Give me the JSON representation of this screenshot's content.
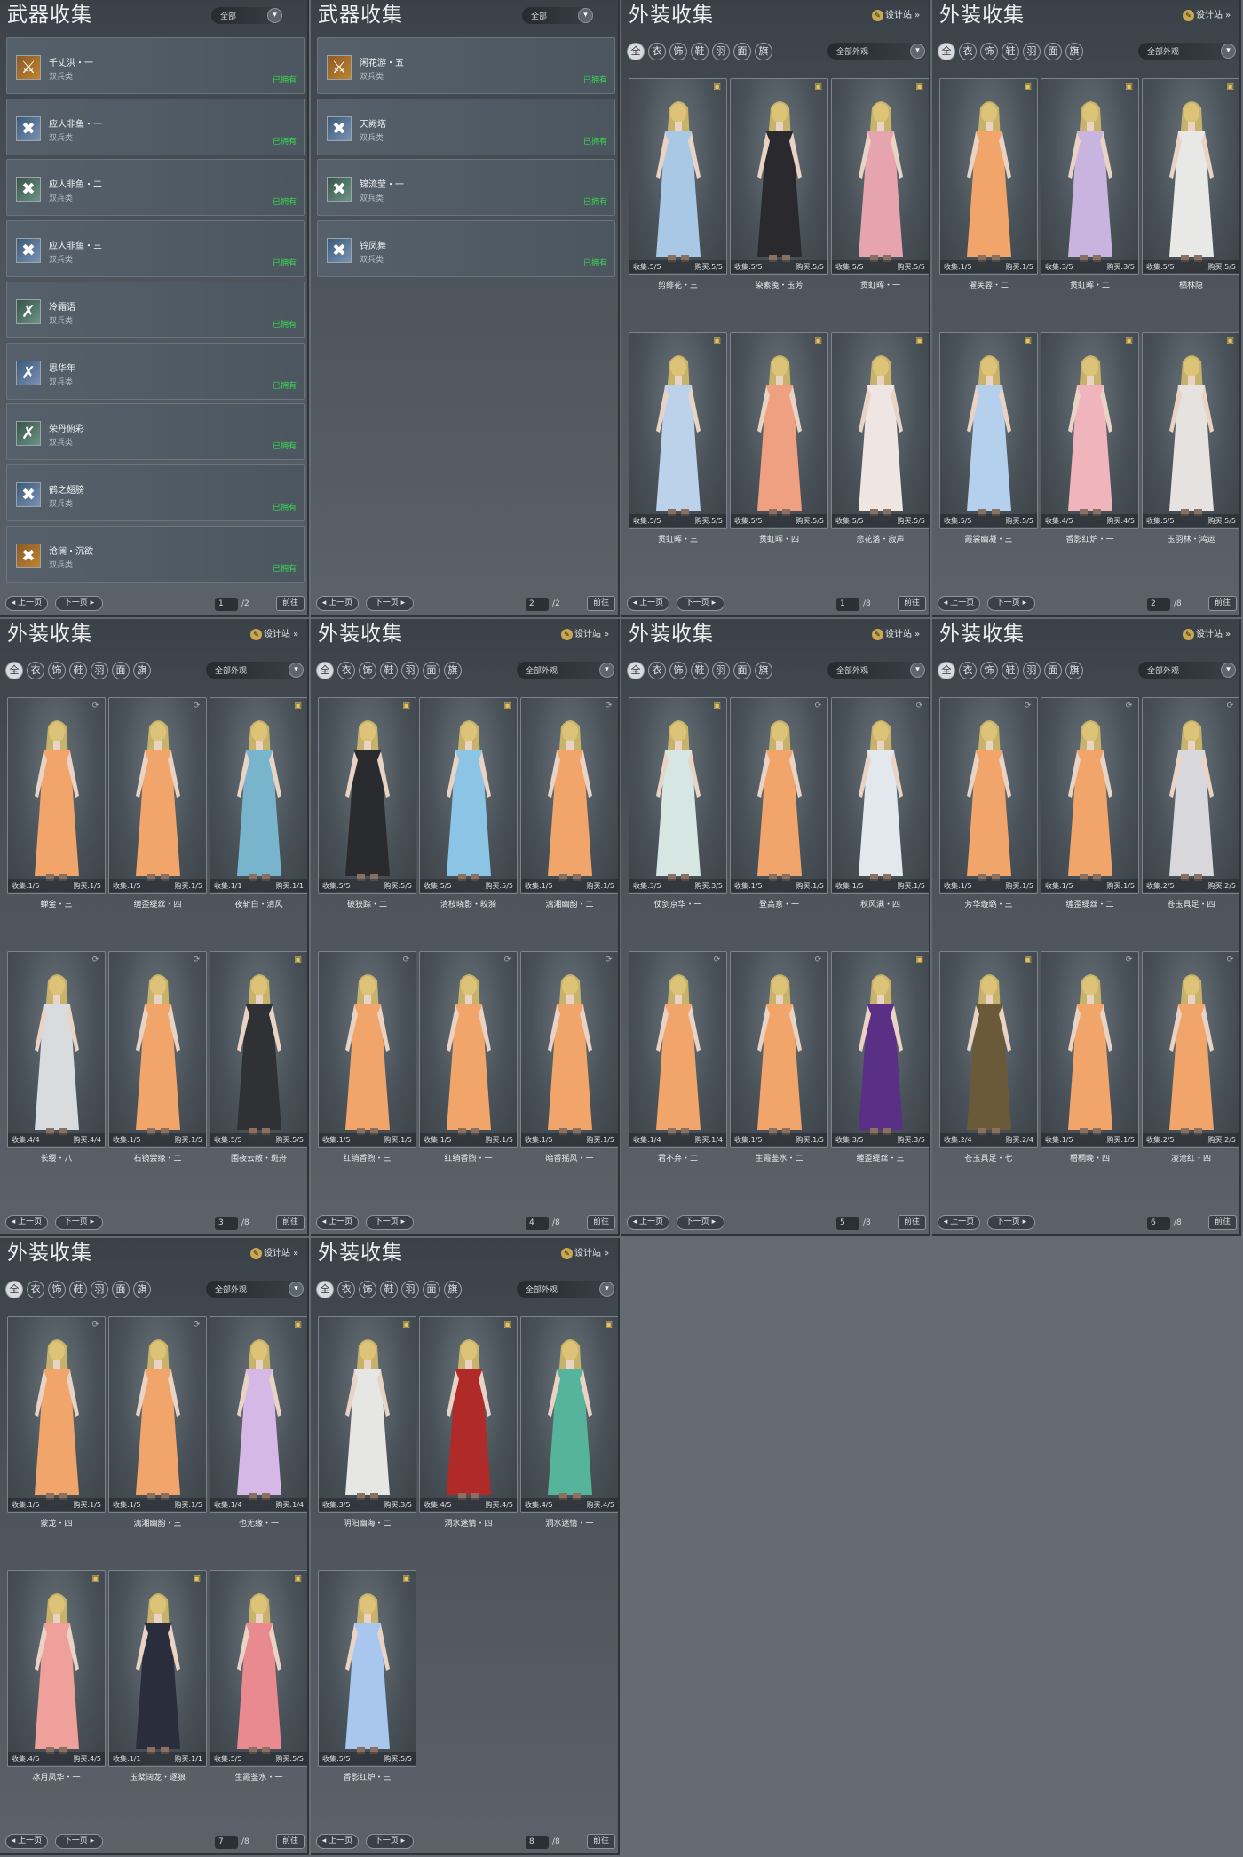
{
  "ui": {
    "weapon_title": "武器收集",
    "outfit_title": "外装收集",
    "filter_all": "全部",
    "filter_outfit": "全部外观",
    "design_station": "设计站",
    "prev": "上一页",
    "next": "下一页",
    "jump": "前往",
    "owned": "已拥有",
    "weapon_type": "双兵类",
    "collect": "收集:",
    "buy": "购买:",
    "filter_icons": [
      "全",
      "衣",
      "饰",
      "鞋",
      "羽",
      "面",
      "旗"
    ]
  },
  "weapon_pages": [
    {
      "page": "1",
      "total": "/2",
      "items": [
        "千丈洪・一",
        "应人非鱼・一",
        "应人非鱼・二",
        "应人非鱼・三",
        "冷霜语",
        "思华年",
        "荣丹俯彩",
        "鹤之翅膀",
        "沧澜・沉欲"
      ]
    },
    {
      "page": "2",
      "total": "/2",
      "items": [
        "闲花游・五",
        "天阙塔",
        "锦流莹・一",
        "铃凤舞"
      ]
    }
  ],
  "outfit_pages": [
    {
      "page": "1",
      "total": "/8",
      "items": [
        {
          "name": "剪绯花・三",
          "c": "5/5",
          "b": "5/5",
          "color": "#a9c8e6",
          "bin": "y"
        },
        {
          "name": "染素笺・玉芳",
          "c": "5/5",
          "b": "5/5",
          "color": "#2a2a2e",
          "bin": "y"
        },
        {
          "name": "贯虹晖・一",
          "c": "5/5",
          "b": "5/5",
          "color": "#e6a4ae",
          "bin": "y"
        },
        {
          "name": "贯虹晖・三",
          "c": "5/5",
          "b": "5/5",
          "color": "#bcd2ea",
          "bin": "y"
        },
        {
          "name": "贯虹晖・四",
          "c": "5/5",
          "b": "5/5",
          "color": "#eea080",
          "bin": "y"
        },
        {
          "name": "悲花落・寂声",
          "c": "5/5",
          "b": "5/5",
          "color": "#efe6e4",
          "bin": "y"
        }
      ]
    },
    {
      "page": "2",
      "total": "/8",
      "items": [
        {
          "name": "濯芙蓉・二",
          "c": "1/5",
          "b": "1/5",
          "color": "#f1a56b",
          "bin": "y"
        },
        {
          "name": "贯虹晖・二",
          "c": "3/5",
          "b": "3/5",
          "color": "#c8b4de",
          "bin": "y"
        },
        {
          "name": "栖林隐",
          "c": "5/5",
          "b": "5/5",
          "color": "#e8e8e6",
          "bin": "y"
        },
        {
          "name": "霞裳幽凝・三",
          "c": "5/5",
          "b": "5/5",
          "color": "#b4d0ec",
          "bin": "y"
        },
        {
          "name": "香影红炉・一",
          "c": "4/5",
          "b": "4/5",
          "color": "#f0b4bc",
          "bin": "y"
        },
        {
          "name": "玉羽林・鸿运",
          "c": "5/5",
          "b": "5/5",
          "color": "#e6e2e0",
          "bin": "y"
        }
      ]
    },
    {
      "page": "3",
      "total": "/8",
      "items": [
        {
          "name": "蝉金・三",
          "c": "1/5",
          "b": "1/5",
          "color": "#f1a56b",
          "bin": "b"
        },
        {
          "name": "缠歪缇丝・四",
          "c": "1/5",
          "b": "1/5",
          "color": "#f1a56b",
          "bin": "b"
        },
        {
          "name": "夜斩白・清风",
          "c": "1/1",
          "b": "1/1",
          "color": "#78b4cc",
          "bin": "y"
        },
        {
          "name": "长缨・八",
          "c": "4/4",
          "b": "4/4",
          "color": "#d8dcdf",
          "bin": "b"
        },
        {
          "name": "石镜尝缘・二",
          "c": "1/5",
          "b": "1/5",
          "color": "#f1a56b",
          "bin": "b"
        },
        {
          "name": "围夜云敝・斑舟",
          "c": "5/5",
          "b": "5/5",
          "color": "#2f3134",
          "bin": "y"
        }
      ]
    },
    {
      "page": "4",
      "total": "/8",
      "items": [
        {
          "name": "破狭踪・二",
          "c": "5/5",
          "b": "5/5",
          "color": "#2a2b2e",
          "bin": "y"
        },
        {
          "name": "清枝晓影・皎漪",
          "c": "5/5",
          "b": "5/5",
          "color": "#8cc4e6",
          "bin": "y"
        },
        {
          "name": "漓湘幽韵・二",
          "c": "1/5",
          "b": "1/5",
          "color": "#f1a56b",
          "bin": "b"
        },
        {
          "name": "红绡香煦・三",
          "c": "1/5",
          "b": "1/5",
          "color": "#f1a56b",
          "bin": "b"
        },
        {
          "name": "红绡香煦・一",
          "c": "1/5",
          "b": "1/5",
          "color": "#f1a56b",
          "bin": "b"
        },
        {
          "name": "暗香摇风・一",
          "c": "1/5",
          "b": "1/5",
          "color": "#f1a56b",
          "bin": "b"
        }
      ]
    },
    {
      "page": "5",
      "total": "/8",
      "items": [
        {
          "name": "仗剑京华・一",
          "c": "3/5",
          "b": "3/5",
          "color": "#d6e6e2",
          "bin": "y"
        },
        {
          "name": "登高意・一",
          "c": "1/5",
          "b": "1/5",
          "color": "#f1a56b",
          "bin": "b"
        },
        {
          "name": "秋风满・四",
          "c": "1/5",
          "b": "1/5",
          "color": "#e2e8ee",
          "bin": "b"
        },
        {
          "name": "君不弃・二",
          "c": "1/4",
          "b": "1/4",
          "color": "#f1a56b",
          "bin": "b"
        },
        {
          "name": "生霞鉴水・二",
          "c": "1/5",
          "b": "1/5",
          "color": "#f1a56b",
          "bin": "b"
        },
        {
          "name": "缠歪缇丝・三",
          "c": "3/5",
          "b": "3/5",
          "color": "#5a2f86",
          "bin": "y"
        }
      ]
    },
    {
      "page": "6",
      "total": "/8",
      "items": [
        {
          "name": "芳华璇璐・三",
          "c": "1/5",
          "b": "1/5",
          "color": "#f1a56b",
          "bin": "b"
        },
        {
          "name": "缠歪缇丝・二",
          "c": "1/5",
          "b": "1/5",
          "color": "#f1a56b",
          "bin": "b"
        },
        {
          "name": "苍玉具足・四",
          "c": "2/5",
          "b": "2/5",
          "color": "#d8d8dc",
          "bin": "b"
        },
        {
          "name": "苍玉具足・七",
          "c": "2/4",
          "b": "2/4",
          "color": "#6b5a3a",
          "bin": "y"
        },
        {
          "name": "梧桐晚・四",
          "c": "1/5",
          "b": "1/5",
          "color": "#f1a56b",
          "bin": "b"
        },
        {
          "name": "凌沧红・四",
          "c": "2/5",
          "b": "2/5",
          "color": "#f1a56b",
          "bin": "b"
        }
      ]
    },
    {
      "page": "7",
      "total": "/8",
      "items": [
        {
          "name": "蒙龙・四",
          "c": "1/5",
          "b": "1/5",
          "color": "#f1a56b",
          "bin": "b"
        },
        {
          "name": "漓湘幽韵・三",
          "c": "1/5",
          "b": "1/5",
          "color": "#f1a56b",
          "bin": "b"
        },
        {
          "name": "也无缘・一",
          "c": "1/4",
          "b": "1/4",
          "color": "#d6b8e6",
          "bin": "y"
        },
        {
          "name": "冰月凤华・一",
          "c": "4/5",
          "b": "4/5",
          "color": "#f0a09a",
          "bin": "y"
        },
        {
          "name": "玉檗阔龙・逐狼",
          "c": "1/1",
          "b": "1/1",
          "color": "#2a2e3c",
          "bin": "y"
        },
        {
          "name": "生霞鉴水・一",
          "c": "5/5",
          "b": "5/5",
          "color": "#e88a90",
          "bin": "y"
        }
      ]
    },
    {
      "page": "8",
      "total": "/8",
      "items": [
        {
          "name": "阴阳幽海・二",
          "c": "3/5",
          "b": "3/5",
          "color": "#e6e6e4",
          "bin": "y"
        },
        {
          "name": "洞水迷情・四",
          "c": "4/5",
          "b": "4/5",
          "color": "#b02a2a",
          "bin": "y"
        },
        {
          "name": "洞水迷情・一",
          "c": "4/5",
          "b": "4/5",
          "color": "#56b49c",
          "bin": "y"
        },
        {
          "name": "香影红炉・三",
          "c": "5/5",
          "b": "5/5",
          "color": "#a8c6ee",
          "bin": "y"
        }
      ]
    }
  ]
}
